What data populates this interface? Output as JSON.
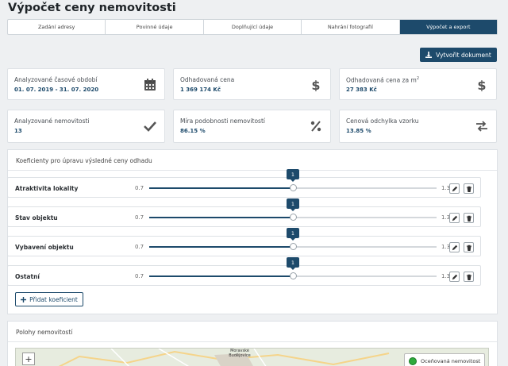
{
  "page": {
    "title": "Výpočet ceny nemovitosti"
  },
  "steps": [
    {
      "label": "Zadání adresy"
    },
    {
      "label": "Povinné údaje"
    },
    {
      "label": "Doplňující údaje"
    },
    {
      "label": "Nahrání fotografií"
    },
    {
      "label": "Výpočet a export"
    }
  ],
  "actions": {
    "create_document": "Vytvořit dokument"
  },
  "cards": {
    "period": {
      "label": "Analyzované časové období",
      "value": "01. 07. 2019 - 31. 07. 2020",
      "icon": "calendar-icon"
    },
    "price": {
      "label": "Odhadovaná cena",
      "value": "1 369 174 Kč",
      "icon": "dollar-icon"
    },
    "price_m2": {
      "label_main": "Odhadovaná cena za m",
      "label_sup": "2",
      "value": "27 383 Kč",
      "icon": "dollar-icon"
    },
    "count": {
      "label": "Analyzované nemovitosti",
      "value": "13",
      "icon": "check-icon"
    },
    "similarity": {
      "label": "Míra podobnosti nemovitostí",
      "value": "86.15 %",
      "icon": "percent-icon"
    },
    "deviation": {
      "label": "Cenová odchylka vzorku",
      "value": "13.85 %",
      "icon": "exchange-icon"
    }
  },
  "coefficients": {
    "title": "Koeficienty pro úpravu výsledné ceny odhadu",
    "min_label": "0.7",
    "max_label": "1.3",
    "min": 0.7,
    "max": 1.3,
    "items": [
      {
        "name": "Atraktivita lokality",
        "value": 1,
        "value_label": "1"
      },
      {
        "name": "Stav objektu",
        "value": 1,
        "value_label": "1"
      },
      {
        "name": "Vybavení objektu",
        "value": 1,
        "value_label": "1"
      },
      {
        "name": "Ostatní",
        "value": 1,
        "value_label": "1"
      }
    ],
    "add_label": "Přidat koeficient"
  },
  "map": {
    "title": "Polohy nemovitostí",
    "zoom_in": "+",
    "place_label": "Moravské Budějovice",
    "legend_label": "Oceňovaná nemovitost",
    "legend_color": "#2eaa3c"
  },
  "colors": {
    "accent": "#1d4a6b"
  }
}
